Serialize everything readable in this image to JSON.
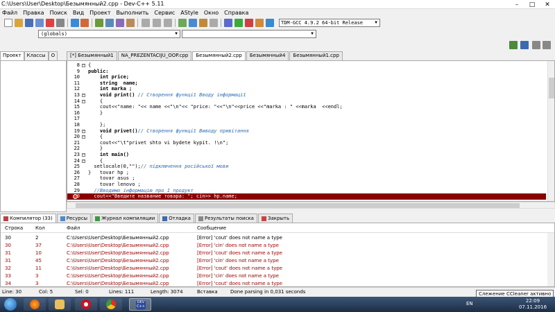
{
  "window": {
    "title": "C:\\Users\\User\\Desktop\\Безымянный2.cpp - Dev-C++ 5.11",
    "minimize": "–",
    "maximize": "□",
    "close": "✕"
  },
  "menu": [
    "Файл",
    "Правка",
    "Поиск",
    "Вид",
    "Проект",
    "Выполнить",
    "Сервис",
    "AStyle",
    "Окно",
    "Справка"
  ],
  "toolbar": {
    "compiler": "TDM-GCC 4.9.2 64-bit Release",
    "scope_combo": "(globals)",
    "symbol_combo": ""
  },
  "left_tabs": [
    "Проект",
    "Классы",
    "О"
  ],
  "editor_tabs": [
    "[*] Безымянный1",
    "NA_PREZENTACIJU_OOP.cpp",
    "Безымянный2.cpp",
    "Безымянный4",
    "Безымянный1.cpp"
  ],
  "code_lines": [
    {
      "n": "8",
      "code": "{"
    },
    {
      "n": "9",
      "code": "public:"
    },
    {
      "n": "10",
      "code": "    int price;"
    },
    {
      "n": "11",
      "code": "    string  name;"
    },
    {
      "n": "12",
      "code": "    int marka ;"
    },
    {
      "n": "13",
      "code": "    void print() ",
      "comment": "// Створення функції Вводу інформації"
    },
    {
      "n": "14",
      "code": "    {"
    },
    {
      "n": "15",
      "code": "    cout<<\"name: \"<< name <<\"\\n\"<< \"price: \"<<\"\\n\"<<price <<\"marka : \" <<marka  <<endl;"
    },
    {
      "n": "16",
      "code": "    }"
    },
    {
      "n": "17",
      "code": ""
    },
    {
      "n": "18",
      "code": "    };"
    },
    {
      "n": "19",
      "code": "    void privet()",
      "comment": "// Створення функції Виводу привітання"
    },
    {
      "n": "20",
      "code": "    {"
    },
    {
      "n": "21",
      "code": "    cout<<\"\\t\"privet shto vi bydete kypit. !\\n\";"
    },
    {
      "n": "22",
      "code": "    }"
    },
    {
      "n": "23",
      "code": "    int main()"
    },
    {
      "n": "24",
      "code": "    {"
    },
    {
      "n": "25",
      "code": "  setlocale(0,\"\");",
      "comment": "// підключення російської мови"
    },
    {
      "n": "26",
      "code": "}   tovar hp ;"
    },
    {
      "n": "27",
      "code": "    tovar asus ;"
    },
    {
      "n": "28",
      "code": "    tovar lenovo ;"
    },
    {
      "n": "29",
      "code": "  ",
      "comment": "//Вводимо інформацію про 1 продукт"
    },
    {
      "n": "30",
      "code": "  cout<<\"Введите название товара: \"; cin>> hp.name;",
      "error": true
    }
  ],
  "bottom_tabs": [
    "Компилятор (33)",
    "Ресурсы",
    "Журнал компиляции",
    "Отладка",
    "Результаты поиска",
    "Закрыть"
  ],
  "messages": {
    "headers": {
      "line": "Строка",
      "col": "Кол",
      "file": "Файл",
      "message": "Сообщение"
    },
    "rows": [
      {
        "line": "30",
        "col": "2",
        "file": "C:\\Users\\User\\Desktop\\Безымянный2.cpp",
        "message": "[Error] 'cout' does not name a type",
        "first": true
      },
      {
        "line": "30",
        "col": "37",
        "file": "C:\\Users\\User\\Desktop\\Безымянный2.cpp",
        "message": "[Error] 'cin' does not name a type"
      },
      {
        "line": "31",
        "col": "10",
        "file": "C:\\Users\\User\\Desktop\\Безымянный2.cpp",
        "message": "[Error] 'cout' does not name a type"
      },
      {
        "line": "31",
        "col": "45",
        "file": "C:\\Users\\User\\Desktop\\Безымянный2.cpp",
        "message": "[Error] 'cin' does not name a type"
      },
      {
        "line": "32",
        "col": "11",
        "file": "C:\\Users\\User\\Desktop\\Безымянный2.cpp",
        "message": "[Error] 'cout' does not name a type"
      },
      {
        "line": "33",
        "col": "3",
        "file": "C:\\Users\\User\\Desktop\\Безымянный2.cpp",
        "message": "[Error] 'cin' does not name a type"
      },
      {
        "line": "34",
        "col": "3",
        "file": "C:\\Users\\User\\Desktop\\Безымянный2.cpp",
        "message": "[Error] 'cout' does not name a type"
      }
    ]
  },
  "status": {
    "line": "Line:  30",
    "col": "Col:   5",
    "sel": "Sel:   0",
    "lines": "Lines:  111",
    "length": "Length:  3074",
    "mode": "Вставка",
    "parse": "Done parsing in 0,031 seconds"
  },
  "tooltip": "Слежение CCleaner активно",
  "taskbar": {
    "lang": "EN",
    "time": "22:09",
    "date": "07.11.2016",
    "active_app": "DEV C++"
  }
}
